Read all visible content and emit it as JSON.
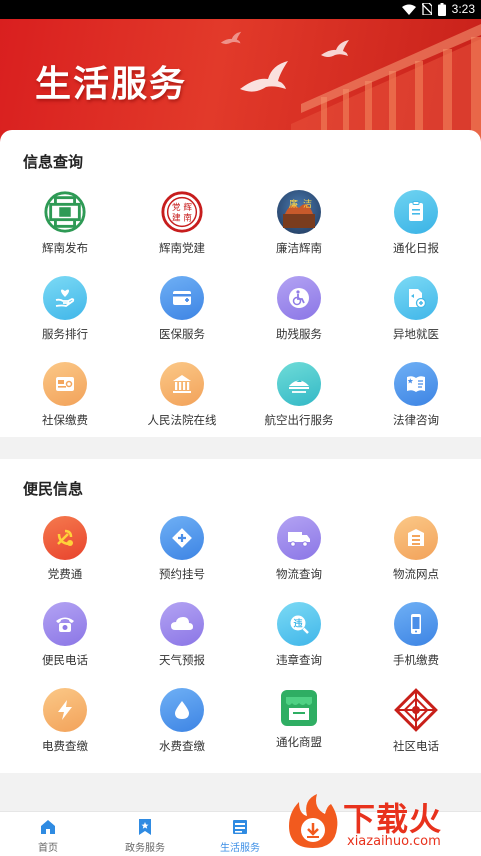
{
  "status_bar": {
    "time": "3:23",
    "icons": [
      "wifi-icon",
      "no-sim-icon",
      "battery-icon"
    ]
  },
  "banner": {
    "title": "生活服务"
  },
  "sections": [
    {
      "title": "信息查询",
      "items": [
        {
          "label": "辉南发布",
          "icon": "huinan-release-logo"
        },
        {
          "label": "辉南党建",
          "icon": "party-building-seal"
        },
        {
          "label": "廉洁辉南",
          "icon": "integrity-huinan-logo"
        },
        {
          "label": "通化日报",
          "icon": "clipboard-icon"
        },
        {
          "label": "服务排行",
          "icon": "hand-heart-icon"
        },
        {
          "label": "医保服务",
          "icon": "medical-card-icon"
        },
        {
          "label": "助残服务",
          "icon": "wheelchair-icon"
        },
        {
          "label": "异地就医",
          "icon": "medical-transfer-icon"
        },
        {
          "label": "社保缴费",
          "icon": "social-security-card-icon"
        },
        {
          "label": "人民法院在线",
          "icon": "court-building-icon"
        },
        {
          "label": "航空出行服务",
          "icon": "airport-icon"
        },
        {
          "label": "法律咨询",
          "icon": "law-book-icon"
        }
      ]
    },
    {
      "title": "便民信息",
      "items": [
        {
          "label": "党费通",
          "icon": "party-emblem-icon"
        },
        {
          "label": "预约挂号",
          "icon": "medical-cross-icon"
        },
        {
          "label": "物流查询",
          "icon": "truck-icon"
        },
        {
          "label": "物流网点",
          "icon": "store-icon"
        },
        {
          "label": "便民电话",
          "icon": "telephone-icon"
        },
        {
          "label": "天气预报",
          "icon": "cloud-icon"
        },
        {
          "label": "违章查询",
          "icon": "violation-search-icon"
        },
        {
          "label": "手机缴费",
          "icon": "mobile-phone-icon"
        },
        {
          "label": "电费查缴",
          "icon": "lightning-icon"
        },
        {
          "label": "水费查缴",
          "icon": "water-drop-icon"
        },
        {
          "label": "通化商盟",
          "icon": "shop-awning-icon"
        },
        {
          "label": "社区电话",
          "icon": "community-knot-icon"
        }
      ]
    }
  ],
  "tab_bar": {
    "tabs": [
      {
        "label": "首页",
        "icon": "home-icon"
      },
      {
        "label": "政务服务",
        "icon": "bookmark-icon"
      },
      {
        "label": "生活服务",
        "icon": "life-service-icon"
      }
    ],
    "active": "生活服务"
  },
  "watermark": {
    "title": "下载火",
    "url": "xiazaihuo.com"
  },
  "colors": {
    "banner_red": "#d91f1f",
    "active_tab": "#3d8fe6",
    "watermark": "#e8321d"
  }
}
